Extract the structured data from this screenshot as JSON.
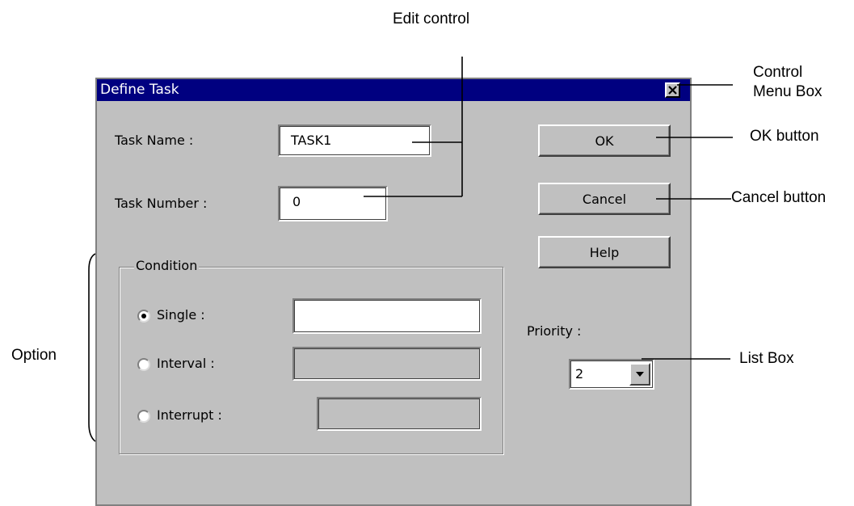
{
  "annotations": {
    "edit_control": "Edit control",
    "control_menu_box_line1": "Control",
    "control_menu_box_line2": "Menu Box",
    "ok_button": "OK button",
    "cancel_button": "Cancel button",
    "list_box": "List Box",
    "option": "Option"
  },
  "dialog": {
    "title": "Define Task",
    "task_name_label": "Task Name :",
    "task_name_value": "TASK1",
    "task_number_label": "Task Number :",
    "task_number_value": "0",
    "condition_group_label": "Condition",
    "radio_single_label": "Single :",
    "radio_interval_label": "Interval :",
    "radio_interrupt_label": "Interrupt :",
    "selected_condition": "Single",
    "ok_label": "OK",
    "cancel_label": "Cancel",
    "help_label": "Help",
    "priority_label": "Priority :",
    "priority_value": "2"
  },
  "colors": {
    "title_bar": "#000080",
    "dialog_face": "#c0c0c0"
  }
}
